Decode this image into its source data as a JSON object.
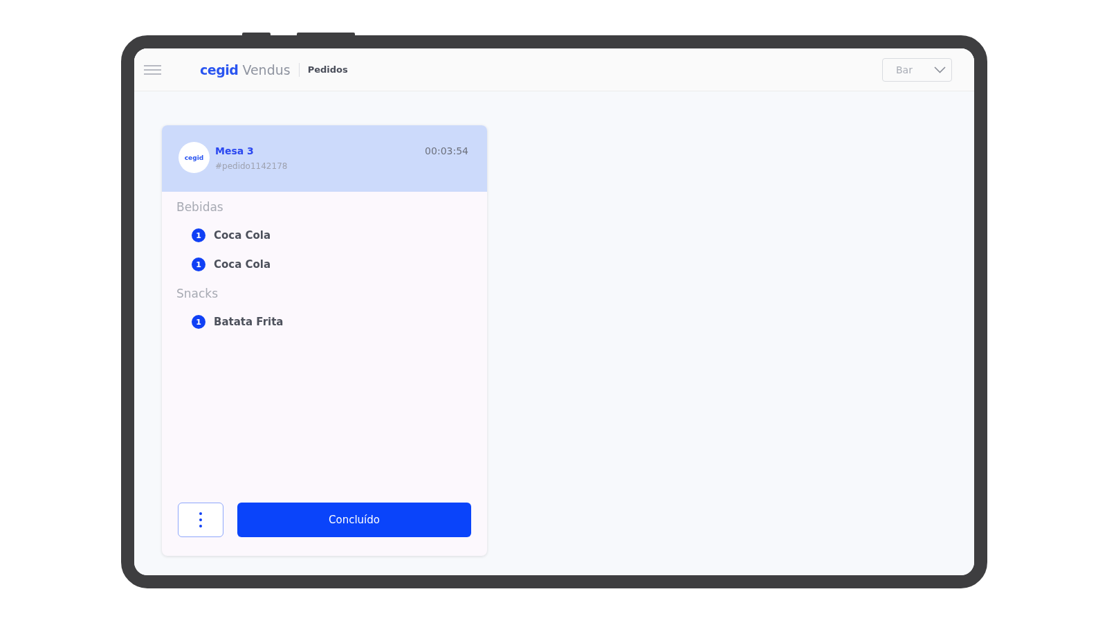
{
  "header": {
    "brand": "cegid",
    "product": "Vendus",
    "page_title": "Pedidos",
    "station_select": {
      "value": "Bar"
    }
  },
  "orders": [
    {
      "avatar_text": "cegid",
      "table": "Mesa 3",
      "order_id": "#pedido1142178",
      "elapsed": "00:03:54",
      "groups": [
        {
          "title": "Bebidas",
          "items": [
            {
              "qty": "1",
              "name": "Coca Cola"
            },
            {
              "qty": "1",
              "name": "Coca Cola"
            }
          ]
        },
        {
          "title": "Snacks",
          "items": [
            {
              "qty": "1",
              "name": "Batata Frita"
            }
          ]
        }
      ],
      "actions": [
        {
          "kind": "more"
        },
        {
          "kind": "primary",
          "label": "Concluído"
        }
      ]
    }
  ]
}
